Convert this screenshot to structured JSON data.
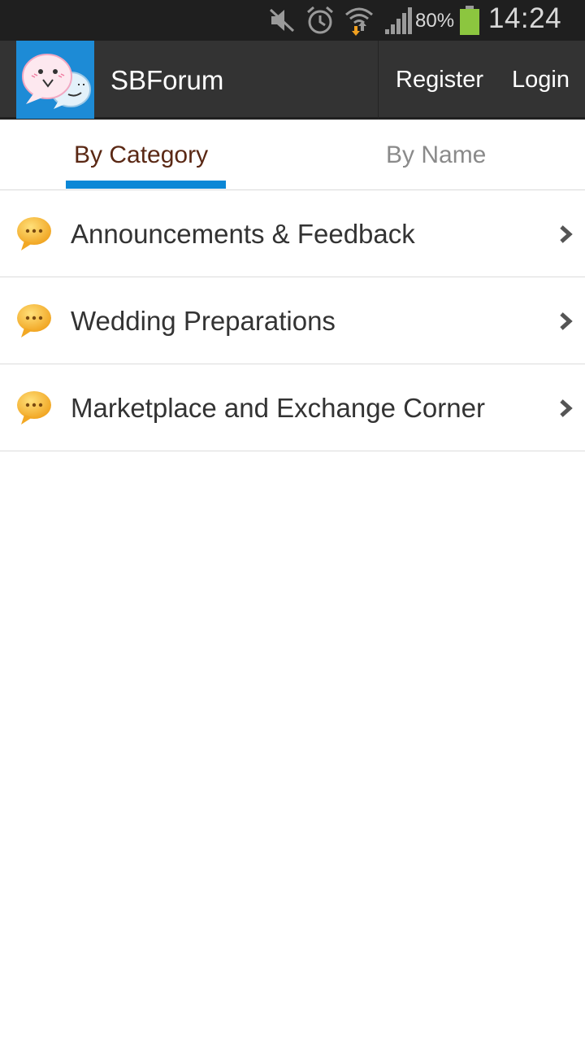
{
  "status_bar": {
    "icons": [
      "mute-icon",
      "alarm-icon",
      "wifi-icon",
      "signal-icon",
      "battery-icon"
    ],
    "battery_percent": "80%",
    "time": "14:24",
    "battery_color": "#8cc63f"
  },
  "app_bar": {
    "title": "SBForum",
    "register_label": "Register",
    "login_label": "Login",
    "logo_bg": "#1d8bd6"
  },
  "tabs": [
    {
      "label": "By Category",
      "active": true
    },
    {
      "label": "By Name",
      "active": false
    }
  ],
  "accent_color": "#0b87d6",
  "categories": [
    {
      "label": "Announcements & Feedback",
      "icon": "speech-bubble-icon"
    },
    {
      "label": "Wedding Preparations",
      "icon": "speech-bubble-icon"
    },
    {
      "label": "Marketplace and Exchange Corner",
      "icon": "speech-bubble-icon"
    }
  ]
}
